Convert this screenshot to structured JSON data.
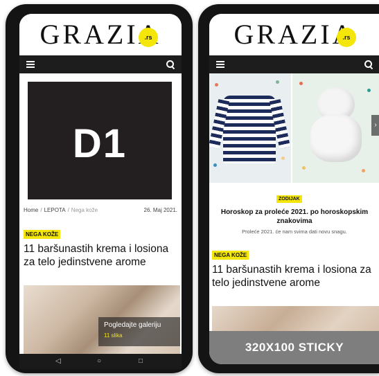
{
  "left_phone": {
    "logo": {
      "text": "GRAZIA",
      "badge": ".rs"
    },
    "navbar": {
      "menu_icon": "hamburger-icon",
      "search_icon": "search-icon"
    },
    "ad": {
      "label": "D1"
    },
    "breadcrumb": {
      "home": "Home",
      "sep": "/",
      "section": "LEPOTA",
      "current": "Nega kože"
    },
    "date": "26. Maj 2021.",
    "article": {
      "tag": "NEGA KOŽE",
      "title": "11 baršunastih krema i losiona za telo jedinstvene arome"
    },
    "gallery": {
      "label": "Pogledajte galeriju",
      "count": "11 slika"
    },
    "softkeys": {
      "back": "◁",
      "home": "○",
      "recent": "□"
    }
  },
  "right_phone": {
    "logo": {
      "text": "GRAZIA",
      "badge": ".rs"
    },
    "navbar": {
      "menu_icon": "hamburger-icon",
      "search_icon": "search-icon"
    },
    "hero_arrow": "›",
    "featured": {
      "tag": "ZODIJAK",
      "headline": "Horoskop za proleće 2021. po horoskopskim znakovima",
      "subtitle": "Proleće 2021. će nam svima dati novu snagu."
    },
    "article": {
      "tag": "NEGA KOŽE",
      "title": "11 baršunastih krema i losiona za telo jedinstvene arome"
    },
    "sticky_ad": "320X100 STICKY"
  },
  "colors": {
    "accent_yellow": "#f5e60a",
    "navbar_dark": "#1d1d1d",
    "ad_dark": "#231f20",
    "sticky_gray": "#7e7e7e"
  }
}
